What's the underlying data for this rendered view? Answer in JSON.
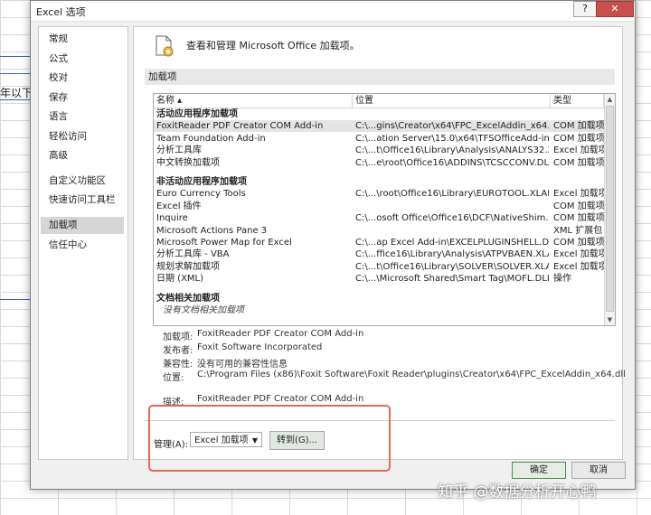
{
  "dialog": {
    "title": "Excel 选项",
    "help": "?",
    "close": "✕"
  },
  "sheet": {
    "partial_text": "年以下"
  },
  "nav": {
    "items": [
      {
        "label": "常规"
      },
      {
        "label": "公式"
      },
      {
        "label": "校对"
      },
      {
        "label": "保存"
      },
      {
        "label": "语言"
      },
      {
        "label": "轻松访问"
      },
      {
        "label": "高级"
      },
      {
        "label": "自定义功能区"
      },
      {
        "label": "快速访问工具栏"
      },
      {
        "label": "加载项",
        "selected": true
      },
      {
        "label": "信任中心"
      }
    ]
  },
  "header": {
    "text": "查看和管理 Microsoft Office 加载项。",
    "icon": "gear-document-icon"
  },
  "section": {
    "title": "加载项"
  },
  "list": {
    "columns": {
      "name": "名称 ▴",
      "location": "位置",
      "type": "类型"
    },
    "active_group": "活动应用程序加载项",
    "active": [
      {
        "name": "FoxitReader PDF Creator COM Add-in",
        "location": "C:\\...gins\\Creator\\x64\\FPC_ExcelAddin_x64.dll",
        "type": "COM 加载项"
      },
      {
        "name": "Team Foundation Add-in",
        "location": "C:\\...ation Server\\15.0\\x64\\TFSOfficeAdd-in.dll",
        "type": "COM 加载项"
      },
      {
        "name": "分析工具库",
        "location": "C:\\...t\\Office16\\Library\\Analysis\\ANALYS32.XLL",
        "type": "Excel 加载项"
      },
      {
        "name": "中文转换加载项",
        "location": "C:\\...e\\root\\Office16\\ADDINS\\TCSCCONV.DLL",
        "type": "COM 加载项"
      }
    ],
    "inactive_group": "非活动应用程序加载项",
    "inactive": [
      {
        "name": "Euro Currency Tools",
        "location": "C:\\...\\root\\Office16\\Library\\EUROTOOL.XLAM",
        "type": "Excel 加载项"
      },
      {
        "name": "Excel 插件",
        "location": "",
        "type": "COM 加载项"
      },
      {
        "name": "Inquire",
        "location": "C:\\...osoft Office\\Office16\\DCF\\NativeShim.dll",
        "type": "COM 加载项"
      },
      {
        "name": "Microsoft Actions Pane 3",
        "location": "",
        "type": "XML 扩展包"
      },
      {
        "name": "Microsoft Power Map for Excel",
        "location": "C:\\...ap Excel Add-in\\EXCELPLUGINSHELL.DLL",
        "type": "COM 加载项"
      },
      {
        "name": "分析工具库 - VBA",
        "location": "C:\\...ffice16\\Library\\Analysis\\ATPVBAEN.XLAM",
        "type": "Excel 加载项"
      },
      {
        "name": "规划求解加载项",
        "location": "C:\\...t\\Office16\\Library\\SOLVER\\SOLVER.XLAM",
        "type": "Excel 加载项"
      },
      {
        "name": "日期 (XML)",
        "location": "C:\\...\\Microsoft Shared\\Smart Tag\\MOFL.DLL",
        "type": "操作"
      }
    ],
    "doc_group": "文档相关加载项",
    "doc_empty": "没有文档相关加载项"
  },
  "details": {
    "addin_label": "加载项:",
    "addin_value": "FoxitReader PDF Creator COM Add-in",
    "publisher_label": "发布者:",
    "publisher_value": "Foxit Software Incorporated",
    "compat_label": "兼容性:",
    "compat_value": "没有可用的兼容性信息",
    "location_label": "位置:",
    "location_value": "C:\\Program Files (x86)\\Foxit Software\\Foxit Reader\\plugins\\Creator\\x64\\FPC_ExcelAddin_x64.dll",
    "desc_label": "描述:",
    "desc_value": "FoxitReader PDF Creator COM Add-in"
  },
  "manage": {
    "label": "管理(A):",
    "selected": "Excel 加载项",
    "go": "转到(G)..."
  },
  "buttons": {
    "ok": "确定",
    "cancel": "取消"
  },
  "watermark": "知乎 @数据分析开心鸭",
  "colors": {
    "highlight_box": "#e06a5a",
    "selection": "#d6d6d6"
  }
}
